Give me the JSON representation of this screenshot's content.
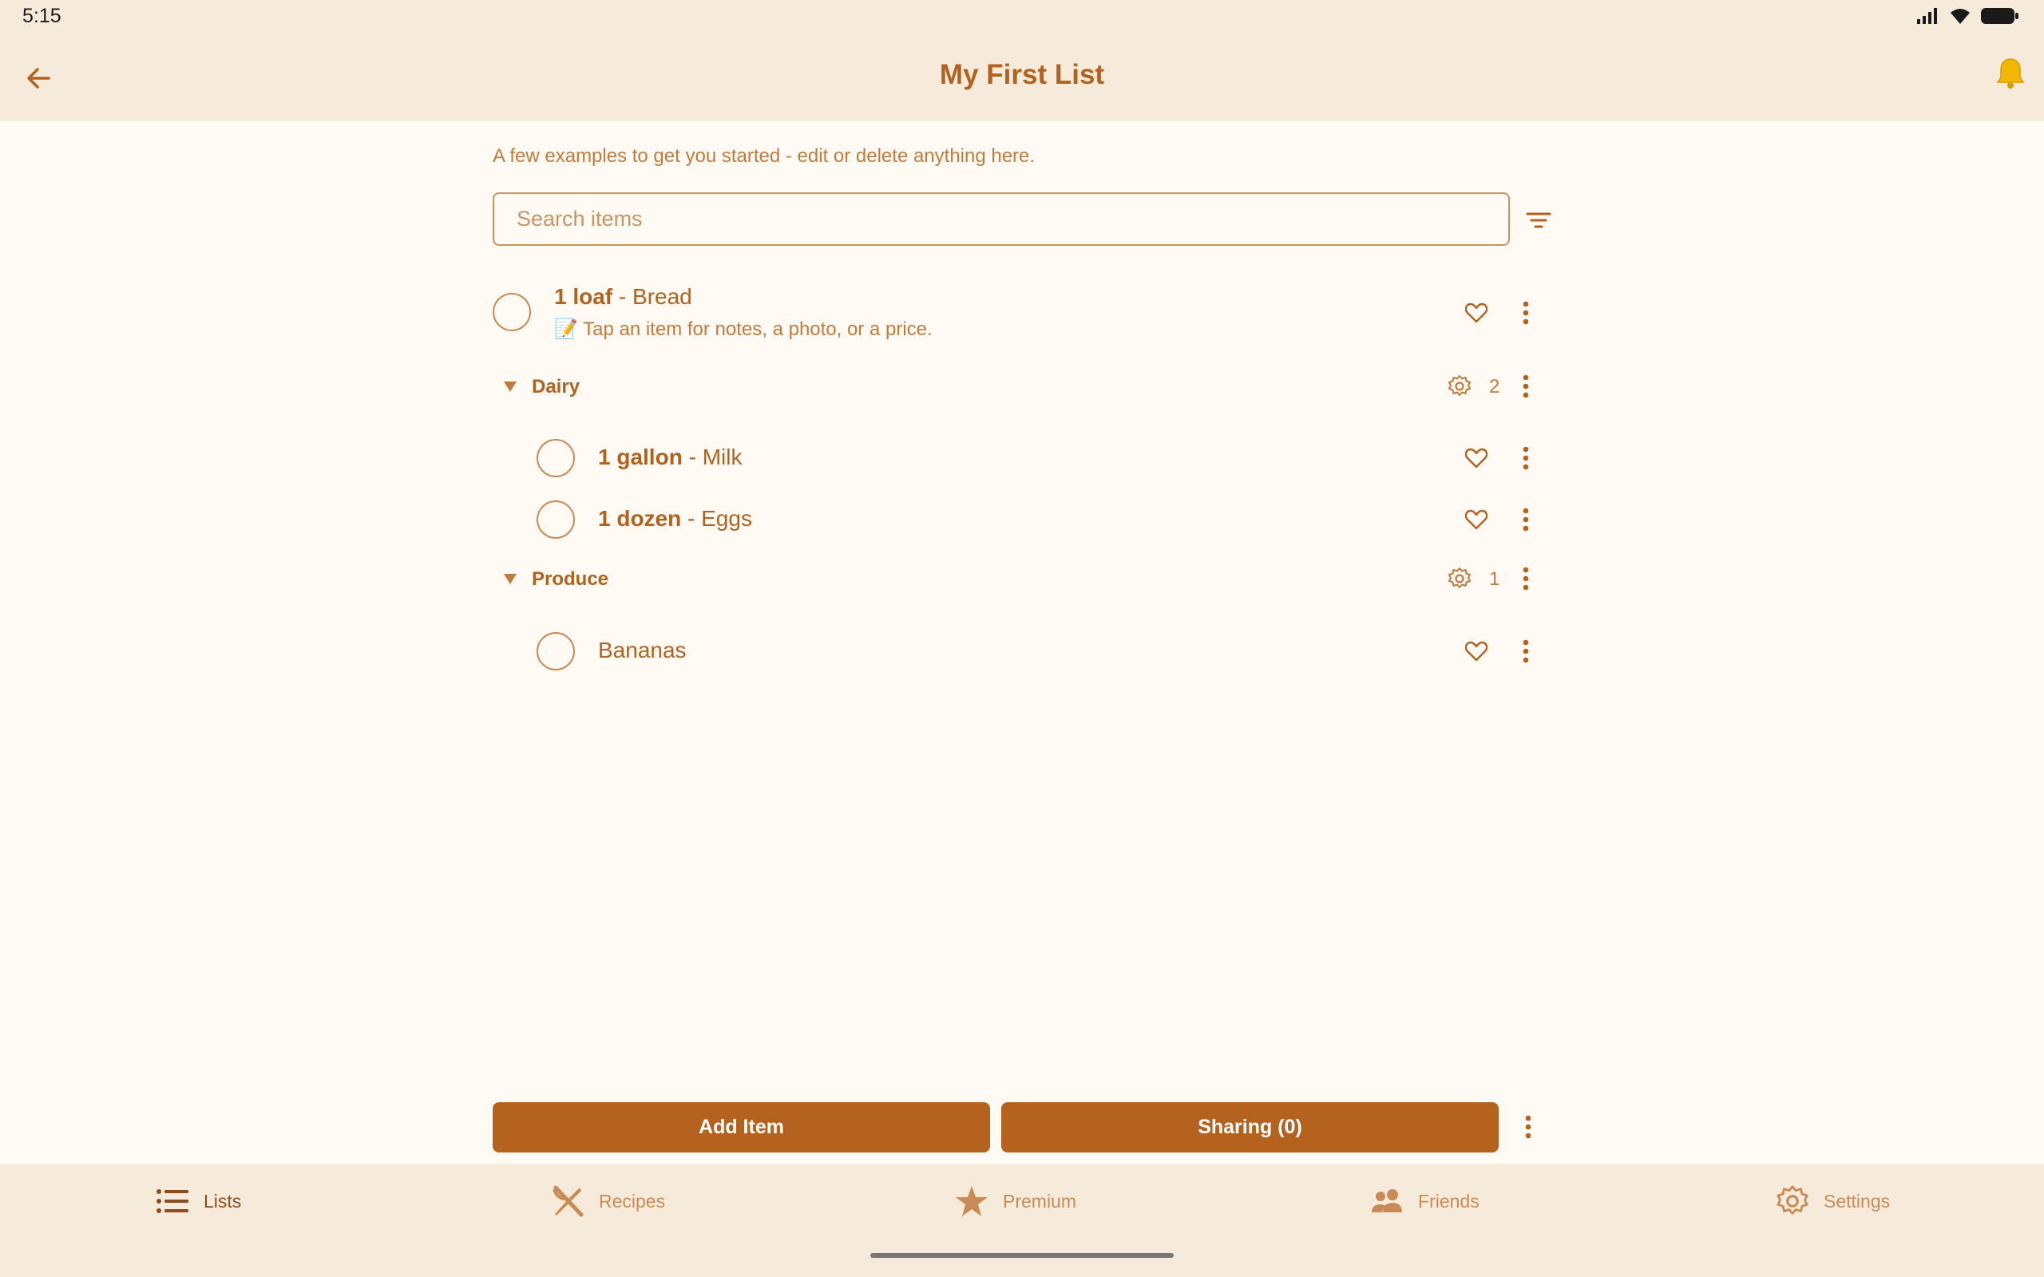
{
  "status_bar": {
    "time": "5:15"
  },
  "app_bar": {
    "title": "My First List"
  },
  "intro": "A few examples to get you started - edit or delete anything here.",
  "search": {
    "placeholder": "Search items",
    "value": ""
  },
  "items": {
    "bread": {
      "qty": "1 loaf",
      "sep": " - ",
      "name": "Bread",
      "note": "📝 Tap an item for notes, a photo, or a price."
    },
    "milk": {
      "qty": "1 gallon",
      "sep": " - ",
      "name": "Milk"
    },
    "eggs": {
      "qty": "1 dozen",
      "sep": " - ",
      "name": "Eggs"
    },
    "bananas": {
      "name": "Bananas"
    }
  },
  "categories": {
    "dairy": {
      "name": "Dairy",
      "count": "2"
    },
    "produce": {
      "name": "Produce",
      "count": "1"
    }
  },
  "actions": {
    "add_item": "Add Item",
    "sharing": "Sharing (0)"
  },
  "nav": {
    "lists": "Lists",
    "recipes": "Recipes",
    "premium": "Premium",
    "friends": "Friends",
    "settings": "Settings",
    "active": "lists"
  },
  "colors": {
    "accent": "#b5621f",
    "header_bg": "#f6ebdb",
    "page_bg": "#fffaf4",
    "bell": "#f2b705"
  },
  "icons": [
    "back-arrow-icon",
    "bell-icon",
    "filter-icon",
    "heart-icon",
    "more-vert-icon",
    "gear-icon",
    "caret-down-icon",
    "list-icon",
    "utensils-icon",
    "star-icon",
    "people-icon",
    "signal-icon",
    "wifi-icon",
    "battery-icon"
  ]
}
